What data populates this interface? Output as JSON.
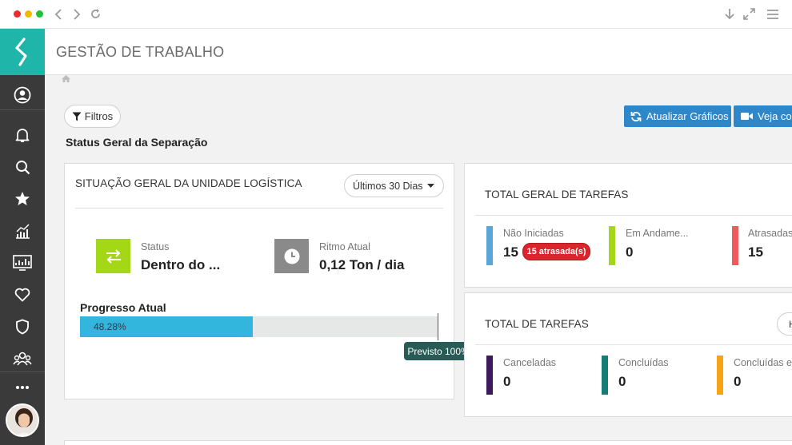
{
  "header": {
    "title": "GESTÃO DE TRABALHO"
  },
  "toolbar": {
    "filters_label": "Filtros",
    "update_label": "Atualizar Gráficos",
    "video_label": "Veja cor"
  },
  "section": {
    "title": "Status Geral da Separação"
  },
  "unit_card": {
    "title": "SITUAÇÃO GERAL DA UNIDADE LOGÍSTICA",
    "period": "Últimos 30 Dias",
    "status_label": "Status",
    "status_value": "Dentro do ...",
    "pace_label": "Ritmo Atual",
    "pace_value": "0,12 Ton / dia",
    "progress_title": "Progresso Atual",
    "progress_text": "48.28%",
    "progress_fraction": 0.4828,
    "forecast_label": "Previsto 100%"
  },
  "total_general": {
    "title": "TOTAL GERAL DE TAREFAS",
    "items": [
      {
        "label": "Não Iniciadas",
        "value": "15",
        "color": "#5aa6d8"
      },
      {
        "label": "Em Andame...",
        "value": "0",
        "color": "#a4d816"
      },
      {
        "label": "Atrasadas",
        "value": "15",
        "color": "#f15a5a"
      }
    ],
    "late_badge": "15 atrasada(s)"
  },
  "total_tasks": {
    "title": "TOTAL DE TAREFAS",
    "pill": "H",
    "items": [
      {
        "label": "Canceladas",
        "value": "0",
        "color": "#3d1a5b"
      },
      {
        "label": "Concluídas",
        "value": "0",
        "color": "#167c75"
      },
      {
        "label": "Concluídas en",
        "value": "0",
        "color": "#f5a418"
      }
    ]
  },
  "colors": {
    "brand": "#1fb5a8",
    "sidebar": "#3a3a3a",
    "primary_button": "#2e87c9",
    "status_green": "#a4d816",
    "pace_gray": "#8a8a8a",
    "progress_fill": "#33b6de",
    "tooltip": "#285a56"
  }
}
